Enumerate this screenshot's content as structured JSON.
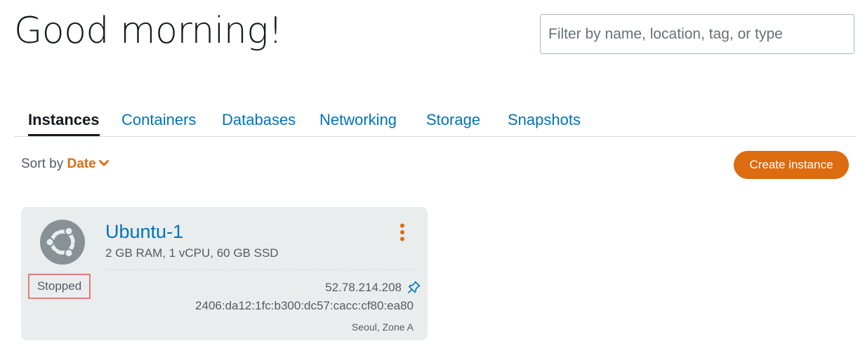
{
  "greeting": "Good morning!",
  "search": {
    "placeholder": "Filter by name, location, tag, or type",
    "value": ""
  },
  "tabs": [
    {
      "label": "Instances",
      "active": true
    },
    {
      "label": "Containers",
      "active": false
    },
    {
      "label": "Databases",
      "active": false
    },
    {
      "label": "Networking",
      "active": false
    },
    {
      "label": "Storage",
      "active": false
    },
    {
      "label": "Snapshots",
      "active": false
    }
  ],
  "sort": {
    "prefix": "Sort by",
    "value": "Date",
    "icon": "chevron-down-icon"
  },
  "create_button": {
    "label": "Create instance"
  },
  "instance": {
    "os_icon": "ubuntu-logo-icon",
    "name": "Ubuntu-1",
    "specs": "2 GB RAM, 1 vCPU, 60 GB SSD",
    "status": "Stopped",
    "ipv4": "52.78.214.208",
    "ipv6": "2406:da12:1fc:b300:dc57:cacc:cf80:ea80",
    "location": "Seoul, Zone A",
    "menu_icon": "kebab-menu-icon",
    "pin_icon": "pin-icon"
  },
  "colors": {
    "accent_orange": "#dd6b10",
    "link_blue": "#0073bb",
    "card_bg": "#eaeded",
    "status_highlight": "#e07b7b"
  }
}
